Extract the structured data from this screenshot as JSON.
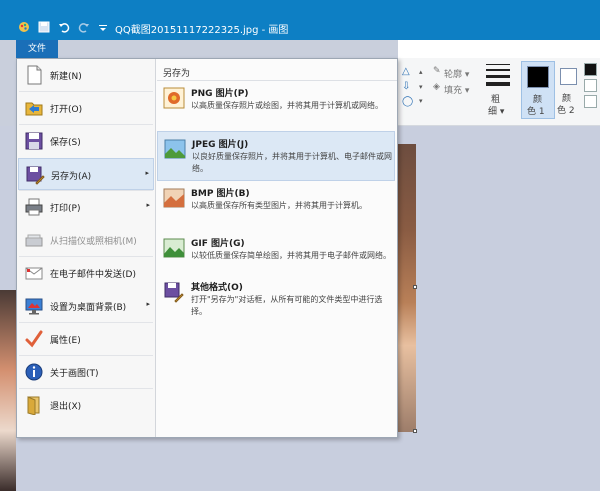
{
  "window": {
    "title": "QQ截图20151117222325.jpg - 画图"
  },
  "file_tab": {
    "label": "文件"
  },
  "ribbon": {
    "outline_label": "轮廓 ▾",
    "fill_label": "填充 ▾",
    "size_label_1": "粗",
    "size_label_2": "细 ▾",
    "color1_label_1": "颜",
    "color1_label_2": "色 1",
    "color2_label_1": "颜",
    "color2_label_2": "色 2",
    "color1_value": "#000000",
    "color2_value": "#ffffff"
  },
  "file_menu": {
    "items": [
      {
        "label": "新建(N)"
      },
      {
        "label": "打开(O)"
      },
      {
        "label": "保存(S)"
      },
      {
        "label": "另存为(A)"
      },
      {
        "label": "打印(P)"
      },
      {
        "label": "从扫描仪或照相机(M)"
      },
      {
        "label": "在电子邮件中发送(D)"
      },
      {
        "label": "设置为桌面背景(B)"
      },
      {
        "label": "属性(E)"
      },
      {
        "label": "关于画图(T)"
      },
      {
        "label": "退出(X)"
      }
    ],
    "submenu_arrow": "▸"
  },
  "save_as_submenu": {
    "title": "另存为",
    "items": [
      {
        "title": "PNG 图片(P)",
        "desc": "以高质量保存照片或绘图，并将其用于计算机或网络。"
      },
      {
        "title": "JPEG 图片(J)",
        "desc": "以良好质量保存照片，并将其用于计算机、电子邮件或网络。"
      },
      {
        "title": "BMP 图片(B)",
        "desc": "以高质量保存所有类型图片，并将其用于计算机。"
      },
      {
        "title": "GIF 图片(G)",
        "desc": "以较低质量保存简单绘图，并将其用于电子邮件或网络。"
      },
      {
        "title": "其他格式(O)",
        "desc": "打开\"另存为\"对话框，从所有可能的文件类型中进行选择。"
      }
    ]
  },
  "colors": {
    "titlebar": "#0d7fc4",
    "file_tab": "#1a6fb8",
    "menu_highlight": "#dce8f5"
  }
}
